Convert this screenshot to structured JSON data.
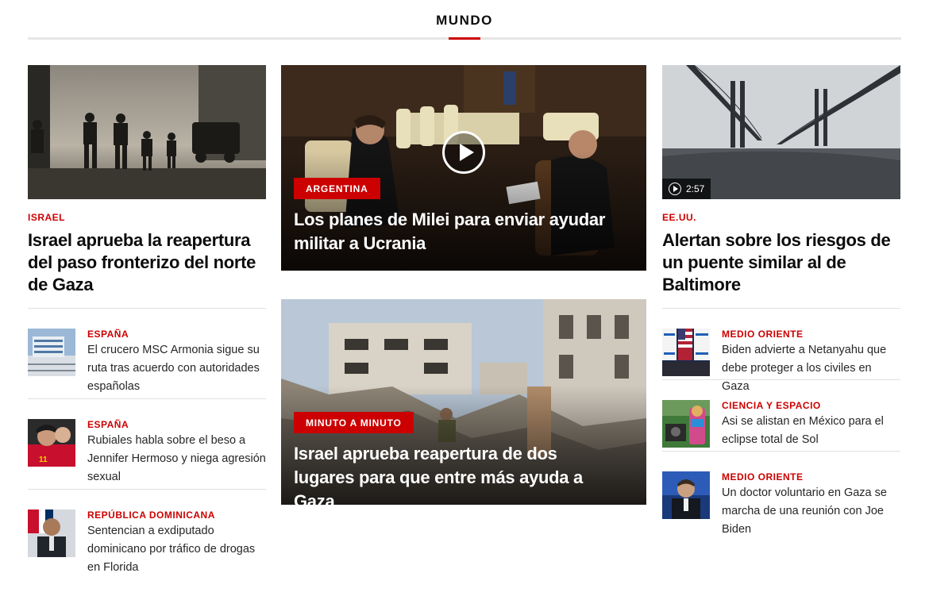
{
  "section": {
    "title": "MUNDO"
  },
  "left": {
    "lead": {
      "kicker": "ISRAEL",
      "headline": "Israel aprueba la reapertura del paso fronterizo del norte de Gaza"
    },
    "items": [
      {
        "kicker": "ESPAÑA",
        "headline": "El crucero MSC Armonia sigue su ruta tras acuerdo con autoridades españolas"
      },
      {
        "kicker": "ESPAÑA",
        "headline": "Rubiales habla sobre el beso a Jennifer Hermoso y niega agresión sexual"
      },
      {
        "kicker": "REPÚBLICA DOMINICANA",
        "headline": "Sentencian a exdiputado dominicano por tráfico de drogas en Florida"
      }
    ]
  },
  "middle": {
    "cards": [
      {
        "label": "ARGENTINA",
        "headline": "Los planes de Milei para enviar ayudar militar a Ucrania",
        "icon": "play-icon"
      },
      {
        "label": "MINUTO A MINUTO",
        "headline": "Israel aprueba reapertura de dos lugares para que entre más ayuda a Gaza"
      }
    ]
  },
  "right": {
    "lead": {
      "kicker": "EE.UU.",
      "headline": "Alertan sobre los riesgos de un puente similar al de Baltimore",
      "duration": "2:57"
    },
    "items": [
      {
        "kicker": "MEDIO ORIENTE",
        "headline": "Biden advierte a Netanyahu que debe proteger a los civiles en Gaza"
      },
      {
        "kicker": "CIENCIA Y ESPACIO",
        "headline": "Asi se alistan en México para el eclipse total de Sol"
      },
      {
        "kicker": "MEDIO ORIENTE",
        "headline": "Un doctor voluntario en Gaza se marcha de una reunión con Joe Biden"
      }
    ]
  },
  "colors": {
    "accent": "#cc0000",
    "text": "#0c0c0c",
    "divider": "#e0e0e0"
  }
}
